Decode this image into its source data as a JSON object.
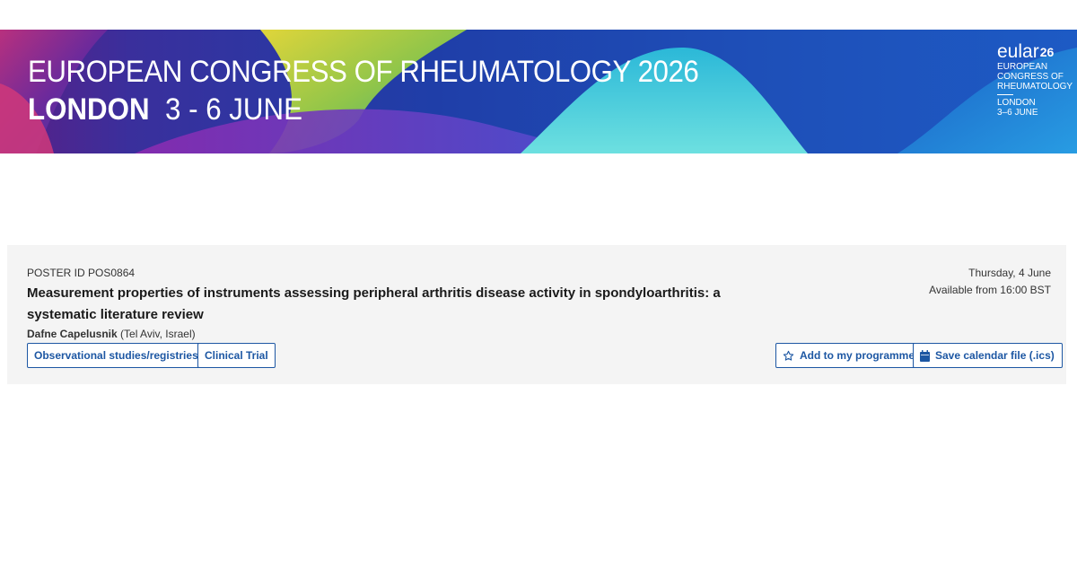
{
  "banner": {
    "title": "EUROPEAN CONGRESS OF RHEUMATOLOGY 2026",
    "city": "LONDON",
    "dates": "3 - 6 JUNE",
    "logo": {
      "word": "eular",
      "number": "26",
      "line1": "EUROPEAN",
      "line2": "CONGRESS OF",
      "line3": "RHEUMATOLOGY",
      "line4": "LONDON",
      "line5": "3–6 JUNE"
    }
  },
  "poster": {
    "id_label": "POSTER ID POS0864",
    "title": "Measurement properties of instruments assessing peripheral arthritis disease activity in spondyloarthritis: a systematic literature review",
    "author_name": "Dafne Capelusnik",
    "author_affiliation": "(Tel Aviv, Israel)",
    "tags": [
      {
        "label": "Observational studies/registries"
      },
      {
        "label": "Clinical Trial"
      }
    ],
    "date": "Thursday, 4 June",
    "availability": "Available from 16:00 BST"
  },
  "actions": {
    "add_label": "Add to my programme",
    "add_icon": "star-outline-icon",
    "calendar_label": "Save calendar file (.ics)",
    "calendar_icon": "calendar-icon"
  },
  "colors": {
    "accent": "#1d57a3",
    "card_bg": "#f4f4f4"
  }
}
